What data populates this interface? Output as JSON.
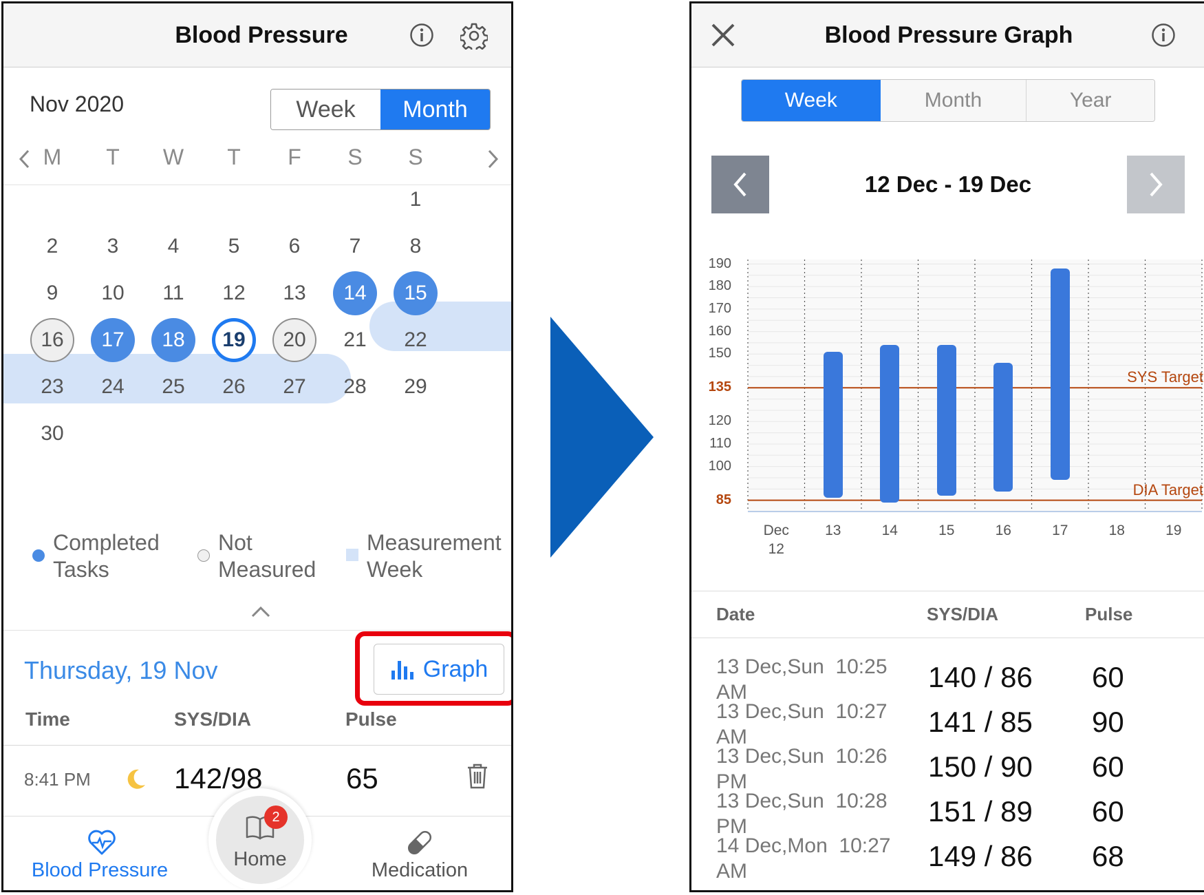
{
  "left": {
    "title": "Blood Pressure",
    "month_label": "Nov 2020",
    "segment": {
      "week": "Week",
      "month": "Month"
    },
    "weekdays": [
      "M",
      "T",
      "W",
      "T",
      "F",
      "S",
      "S"
    ],
    "days": [
      {
        "n": "1",
        "s": ""
      },
      {
        "n": "2",
        "s": ""
      },
      {
        "n": "3",
        "s": ""
      },
      {
        "n": "4",
        "s": ""
      },
      {
        "n": "5",
        "s": ""
      },
      {
        "n": "6",
        "s": ""
      },
      {
        "n": "7",
        "s": ""
      },
      {
        "n": "8",
        "s": ""
      },
      {
        "n": "9",
        "s": ""
      },
      {
        "n": "10",
        "s": ""
      },
      {
        "n": "11",
        "s": ""
      },
      {
        "n": "12",
        "s": ""
      },
      {
        "n": "13",
        "s": ""
      },
      {
        "n": "14",
        "s": "done"
      },
      {
        "n": "15",
        "s": "done"
      },
      {
        "n": "16",
        "s": "nm"
      },
      {
        "n": "17",
        "s": "done"
      },
      {
        "n": "18",
        "s": "done"
      },
      {
        "n": "19",
        "s": "today"
      },
      {
        "n": "20",
        "s": "nm"
      },
      {
        "n": "21",
        "s": ""
      },
      {
        "n": "22",
        "s": ""
      },
      {
        "n": "23",
        "s": ""
      },
      {
        "n": "24",
        "s": ""
      },
      {
        "n": "25",
        "s": ""
      },
      {
        "n": "26",
        "s": ""
      },
      {
        "n": "27",
        "s": ""
      },
      {
        "n": "28",
        "s": ""
      },
      {
        "n": "29",
        "s": ""
      },
      {
        "n": "30",
        "s": ""
      }
    ],
    "legend": {
      "completed_1": "Completed",
      "completed_2": "Tasks",
      "not_measured_1": "Not",
      "not_measured_2": "Measured",
      "measurement_1": "Measurement",
      "measurement_2": "Week"
    },
    "selected_date": "Thursday, 19 Nov",
    "graph_button": "Graph",
    "table_headers": {
      "time": "Time",
      "sysdia": "SYS/DIA",
      "pulse": "Pulse"
    },
    "entry": {
      "time": "8:41 PM",
      "sysdia": "142/98",
      "pulse": "65"
    },
    "tabbar": {
      "bp": "Blood Pressure",
      "home": "Home",
      "home_badge": "2",
      "medication": "Medication"
    },
    "colors": {
      "accent": "#1f7af0",
      "completed": "#4a8be3",
      "week_band": "#d4e3f8",
      "highlight": "#e8000d"
    }
  },
  "arrow_color": "#0a5fb8",
  "right": {
    "title": "Blood Pressure Graph",
    "segment": {
      "week": "Week",
      "month": "Month",
      "year": "Year"
    },
    "date_range": "12 Dec - 19 Dec",
    "table_headers": {
      "date": "Date",
      "sysdia": "SYS/DIA",
      "pulse": "Pulse"
    },
    "readings": [
      {
        "date1": "13 Dec,Sun  10:25",
        "date2": "AM",
        "sysdia": "140 / 86",
        "pulse": "60"
      },
      {
        "date1": "13 Dec,Sun  10:27",
        "date2": "AM",
        "sysdia": "141 / 85",
        "pulse": "90"
      },
      {
        "date1": "13 Dec,Sun  10:26",
        "date2": "PM",
        "sysdia": "150 / 90",
        "pulse": "60"
      },
      {
        "date1": "13 Dec,Sun  10:28",
        "date2": "PM",
        "sysdia": "151 / 89",
        "pulse": "60"
      },
      {
        "date1": "14 Dec,Mon  10:27",
        "date2": "AM",
        "sysdia": "149 / 86",
        "pulse": "68"
      }
    ]
  },
  "chart_data": {
    "type": "bar",
    "subtype": "floating range (DIA to SYS)",
    "x_ticks": [
      [
        "Dec",
        "12"
      ],
      [
        "13"
      ],
      [
        "14"
      ],
      [
        "15"
      ],
      [
        "16"
      ],
      [
        "17"
      ],
      [
        "18"
      ],
      [
        "19"
      ]
    ],
    "y_ticks": [
      100,
      110,
      120,
      135,
      150,
      160,
      170,
      180,
      190
    ],
    "y_ticks_highlight": [
      85,
      135
    ],
    "ylim": [
      80,
      192
    ],
    "ranges": [
      {
        "x": 1,
        "low": 86,
        "high": 151
      },
      {
        "x": 2,
        "low": 84,
        "high": 154
      },
      {
        "x": 3,
        "low": 87,
        "high": 154
      },
      {
        "x": 4,
        "low": 89,
        "high": 146
      },
      {
        "x": 5,
        "low": 94,
        "high": 188
      }
    ],
    "targets": [
      {
        "label": "SYS Target",
        "value": 135,
        "color": "#b5470f"
      },
      {
        "label": "DIA Target",
        "value": 85,
        "color": "#b5470f"
      }
    ],
    "bar_color": "#3a78db",
    "grid": true
  }
}
